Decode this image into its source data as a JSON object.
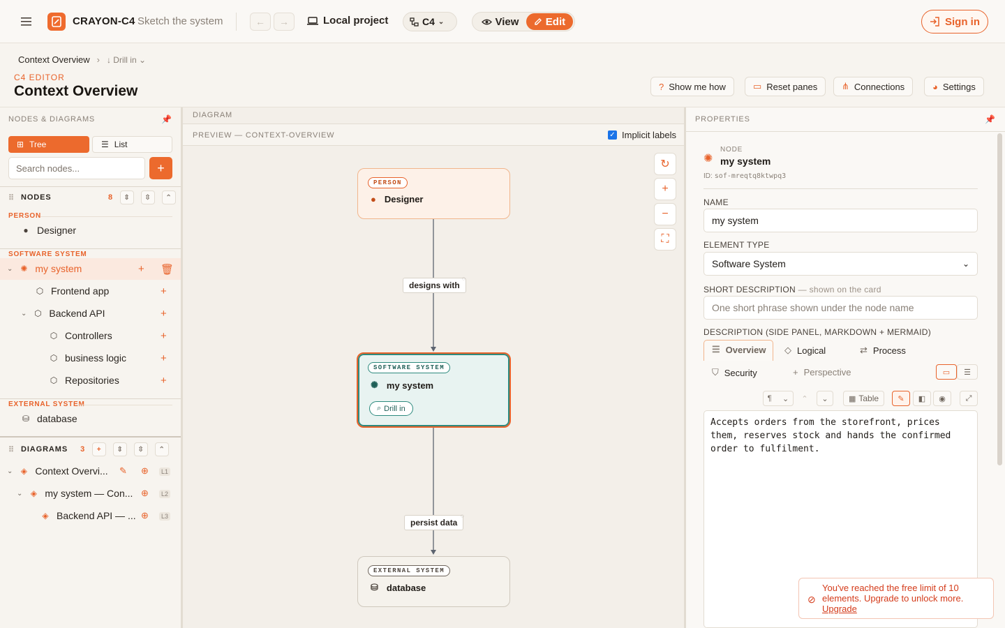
{
  "app": {
    "brand": "CRAYON-C4",
    "tagline": "Sketch the system",
    "project": "Local project",
    "notation": "C4",
    "modes": [
      "View",
      "Edit"
    ],
    "active_mode": "Edit",
    "sign_in": "Sign in"
  },
  "page": {
    "breadcrumb": "Context Overview",
    "drill": "Drill in",
    "eyebrow": "C4 EDITOR",
    "title": "Context Overview",
    "actions": [
      "Show me how",
      "Reset panes",
      "Connections",
      "Settings"
    ]
  },
  "left": {
    "header": "NODES & DIAGRAMS",
    "tabs": [
      "Tree",
      "List"
    ],
    "active_tab": "Tree",
    "search_placeholder": "Search nodes...",
    "nodes_label": "NODES",
    "nodes_count": "8",
    "groups": {
      "person": "PERSON",
      "software": "SOFTWARE SYSTEM",
      "external": "EXTERNAL SYSTEM"
    },
    "items": [
      "Designer",
      "my system",
      "Frontend app",
      "Backend API",
      "Controllers",
      "business logic",
      "Repositories",
      "database"
    ],
    "diagrams_label": "DIAGRAMS",
    "diagrams_count": "3",
    "diagrams": [
      {
        "name": "Context Overvi...",
        "level": "L1"
      },
      {
        "name": "my system — Con...",
        "level": "L2"
      },
      {
        "name": "Backend API — ...",
        "level": "L3"
      }
    ]
  },
  "center": {
    "header": "DIAGRAM",
    "preview": "PREVIEW — CONTEXT-OVERVIEW",
    "implicit_labels": "Implicit labels",
    "nodes": [
      {
        "tag": "PERSON",
        "name": "Designer"
      },
      {
        "tag": "SOFTWARE SYSTEM",
        "name": "my system",
        "drill": "Drill in"
      },
      {
        "tag": "EXTERNAL SYSTEM",
        "name": "database"
      }
    ],
    "edges": [
      "designs with",
      "persist data"
    ]
  },
  "right": {
    "header": "PROPERTIES",
    "kind": "NODE",
    "name": "my system",
    "id_label": "ID:",
    "id": "sof-mreqtq8ktwpq3",
    "name_label": "NAME",
    "name_value": "my system",
    "type_label": "ELEMENT TYPE",
    "type_value": "Software System",
    "short_label": "SHORT DESCRIPTION",
    "short_hint": "— shown on the card",
    "short_placeholder": "One short phrase shown under the node name",
    "desc_label": "DESCRIPTION (SIDE PANEL, MARKDOWN + MERMAID)",
    "desc_tabs": [
      "Overview",
      "Logical",
      "Process",
      "Security",
      "Perspective"
    ],
    "toolbar": {
      "para": "¶",
      "table": "Table"
    },
    "description": "Accepts orders from the storefront, prices\nthem, reserves stock and hands the confirmed\norder to fulfilment.",
    "toast": "You've reached the free limit of 10 elements. Upgrade to unlock more.",
    "toast_link": "Upgrade"
  },
  "colors": {
    "accent": "#e8622a",
    "selected_node_bg": "#e8f3f1",
    "person_bg": "#fdf1e8"
  }
}
